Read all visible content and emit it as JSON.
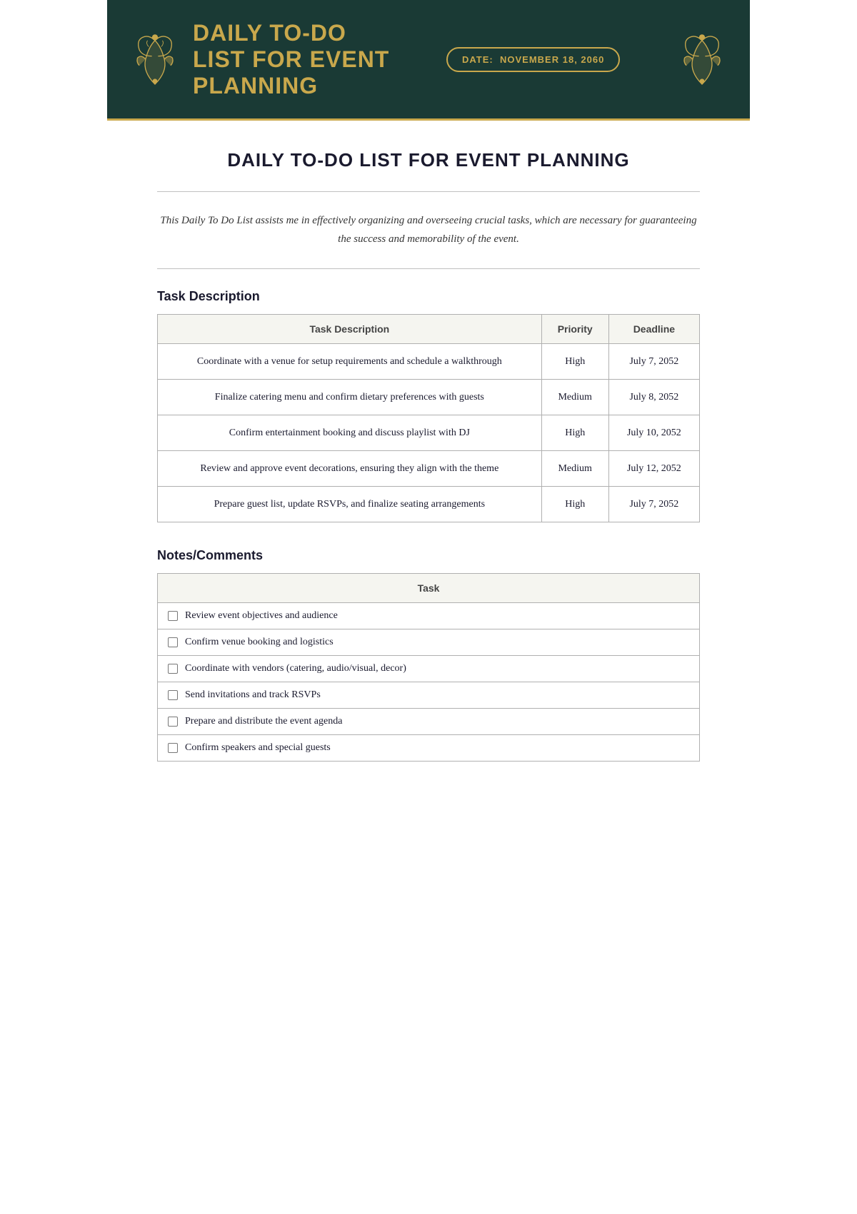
{
  "header": {
    "title_line1": "DAILY TO-DO",
    "title_line2": "LIST FOR EVENT",
    "title_line3": "PLANNING",
    "date_label": "DATE:",
    "date_value": "NOVEMBER 18, 2060"
  },
  "page": {
    "main_title": "DAILY TO-DO LIST FOR EVENT PLANNING",
    "description": "This Daily To Do List assists me in effectively organizing and overseeing crucial tasks, which are necessary for guaranteeing the success and memorability of the event."
  },
  "task_section": {
    "title": "Task Description",
    "columns": {
      "task": "Task Description",
      "priority": "Priority",
      "deadline": "Deadline"
    },
    "rows": [
      {
        "task": "Coordinate with a venue for setup requirements and schedule a walkthrough",
        "priority": "High",
        "deadline": "July 7, 2052"
      },
      {
        "task": "Finalize catering menu and confirm dietary preferences with guests",
        "priority": "Medium",
        "deadline": "July 8, 2052"
      },
      {
        "task": "Confirm entertainment booking and discuss playlist with DJ",
        "priority": "High",
        "deadline": "July 10, 2052"
      },
      {
        "task": "Review and approve event decorations, ensuring they align with the theme",
        "priority": "Medium",
        "deadline": "July 12, 2052"
      },
      {
        "task": "Prepare guest list, update RSVPs, and finalize seating arrangements",
        "priority": "High",
        "deadline": "July 7, 2052"
      }
    ]
  },
  "notes_section": {
    "title": "Notes/Comments",
    "column_header": "Task",
    "items": [
      "Review event objectives and audience",
      "Confirm venue booking and logistics",
      "Coordinate with vendors (catering, audio/visual, decor)",
      "Send invitations and track RSVPs",
      "Prepare and distribute the event agenda",
      "Confirm speakers and special guests"
    ]
  }
}
